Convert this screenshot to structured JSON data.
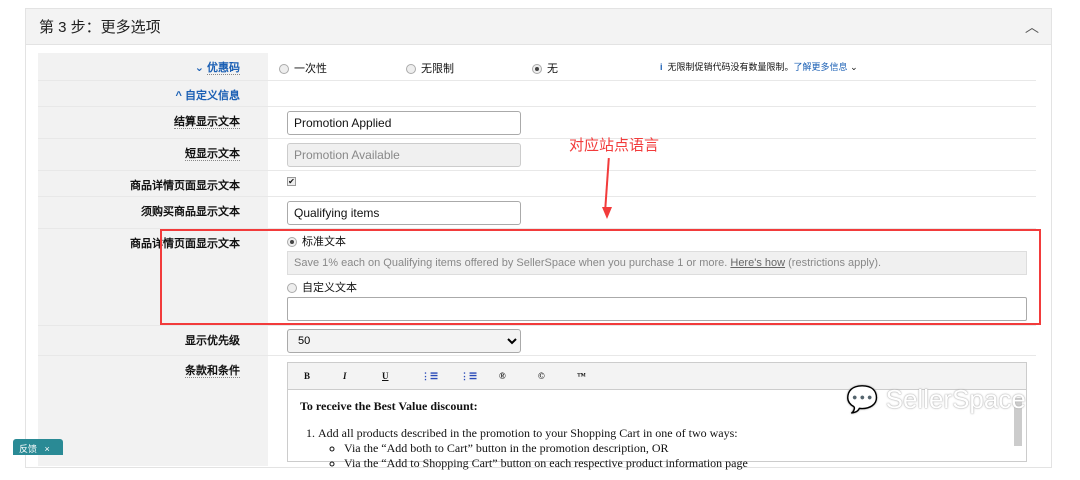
{
  "header": {
    "title": "第 3 步：更多选项"
  },
  "rows": {
    "coupon": {
      "label": "优惠码",
      "options": [
        "一次性",
        "无限制",
        "无"
      ],
      "selected": "无",
      "info": "无限制促销代码没有数量限制。",
      "learn_more": "了解更多信息"
    },
    "custom": {
      "label": "自定义信息"
    },
    "checkout": {
      "label": "结算显示文本",
      "value": "Promotion Applied"
    },
    "short": {
      "label": "短显示文本",
      "value": "Promotion Available"
    },
    "detail_check": {
      "label": "商品详情页面显示文本",
      "checked": true
    },
    "qualifying": {
      "label": "须购买商品显示文本",
      "value": "Qualifying items"
    },
    "detail_text": {
      "label": "商品详情页面显示文本",
      "standard_label": "标准文本",
      "standard_text": "Save 1% each on Qualifying items offered by SellerSpace when you purchase 1 or more. ",
      "heres_how": "Here's how",
      "restrictions": " (restrictions apply).",
      "custom_label": "自定义文本",
      "custom_value": ""
    },
    "priority": {
      "label": "显示优先级",
      "value": "50"
    },
    "terms": {
      "label": "条款和条件",
      "toolbar": [
        "B",
        "I",
        "U",
        "ol",
        "ul",
        "®",
        "©",
        "™"
      ],
      "heading": "To receive the Best Value discount:",
      "item1": "Add all products described in the promotion to your Shopping Cart in one of two ways:",
      "sub1": "Via the “Add both to Cart” button in the promotion description, OR",
      "sub2": "Via the “Add to Shopping Cart” button on each respective product information page"
    }
  },
  "annotation": "对应站点语言",
  "watermark": "SellerSpace",
  "feedback": {
    "label": "反馈",
    "close": "×"
  },
  "colors": {
    "annotation": "#f23b3b",
    "link": "#1a5fb4",
    "feedback": "#2a8a95"
  }
}
